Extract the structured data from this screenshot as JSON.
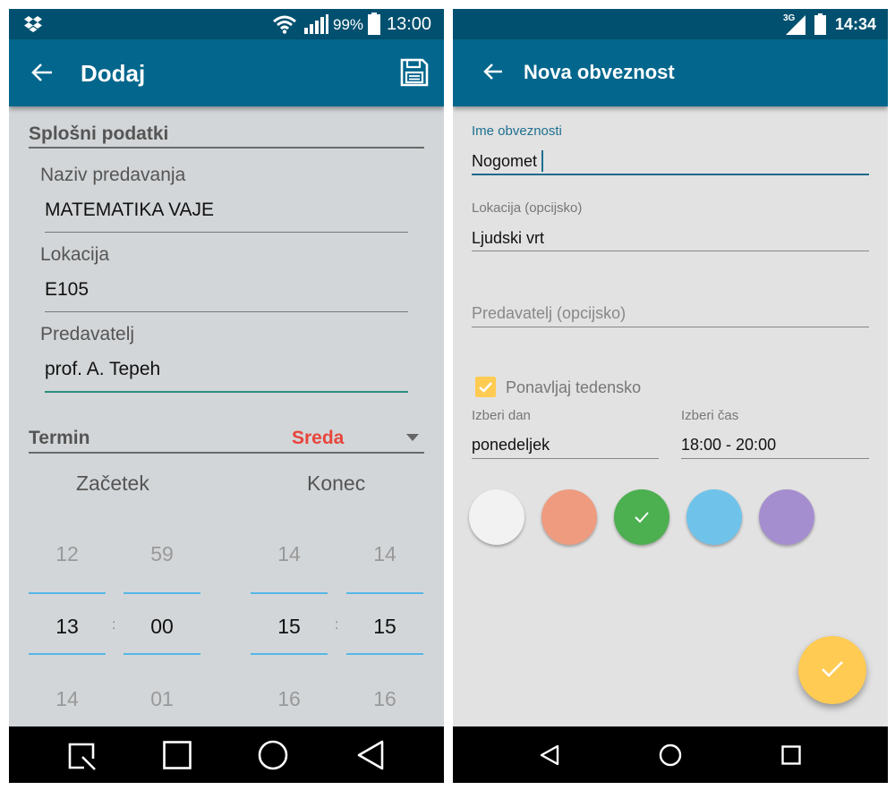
{
  "left": {
    "status": {
      "battery": "99%",
      "time": "13:00"
    },
    "appbar": {
      "title": "Dodaj"
    },
    "section_general": "Splošni podatki",
    "fields": [
      {
        "label": "Naziv predavanja",
        "value": "MATEMATIKA VAJE"
      },
      {
        "label": "Lokacija",
        "value": "E105"
      },
      {
        "label": "Predavatelj",
        "value": "prof. A. Tepeh"
      }
    ],
    "section_term": "Termin",
    "day_selected": "Sreda",
    "start_label": "Začetek",
    "end_label": "Konec",
    "pickers": {
      "start_hour": {
        "prev": "12",
        "current": "13",
        "next": "14"
      },
      "start_min": {
        "prev": "59",
        "current": "00",
        "next": "01"
      },
      "end_hour": {
        "prev": "14",
        "current": "15",
        "next": "16"
      },
      "end_min": {
        "prev": "14",
        "current": "15",
        "next": "16"
      },
      "separator": ":"
    },
    "colors": {
      "appbar": "#03668c",
      "accent_red": "#e8453c",
      "picker_line": "#56b7e6",
      "focus_line": "#2a8f80"
    }
  },
  "right": {
    "status": {
      "network": "3G",
      "time": "14:34"
    },
    "appbar": {
      "title": "Nova obveznost"
    },
    "name_field": {
      "label": "Ime obveznosti",
      "value": "Nogomet"
    },
    "location_field": {
      "label": "Lokacija (opcijsko)",
      "value": "Ljudski vrt"
    },
    "lecturer_field": {
      "placeholder": "Predavatelj (opcijsko)"
    },
    "repeat": {
      "label": "Ponavljaj tedensko",
      "checked": true
    },
    "day_select": {
      "label": "Izberi dan",
      "value": "ponedeljek"
    },
    "time_select": {
      "label": "Izberi čas",
      "value": "18:00 - 20:00"
    },
    "color_options": [
      {
        "color": "#f2f2f2",
        "selected": false
      },
      {
        "color": "#ee9b80",
        "selected": false
      },
      {
        "color": "#4caf50",
        "selected": true
      },
      {
        "color": "#6fc3ea",
        "selected": false
      },
      {
        "color": "#a58ecf",
        "selected": false
      }
    ],
    "fab_color": "#ffcb52"
  }
}
